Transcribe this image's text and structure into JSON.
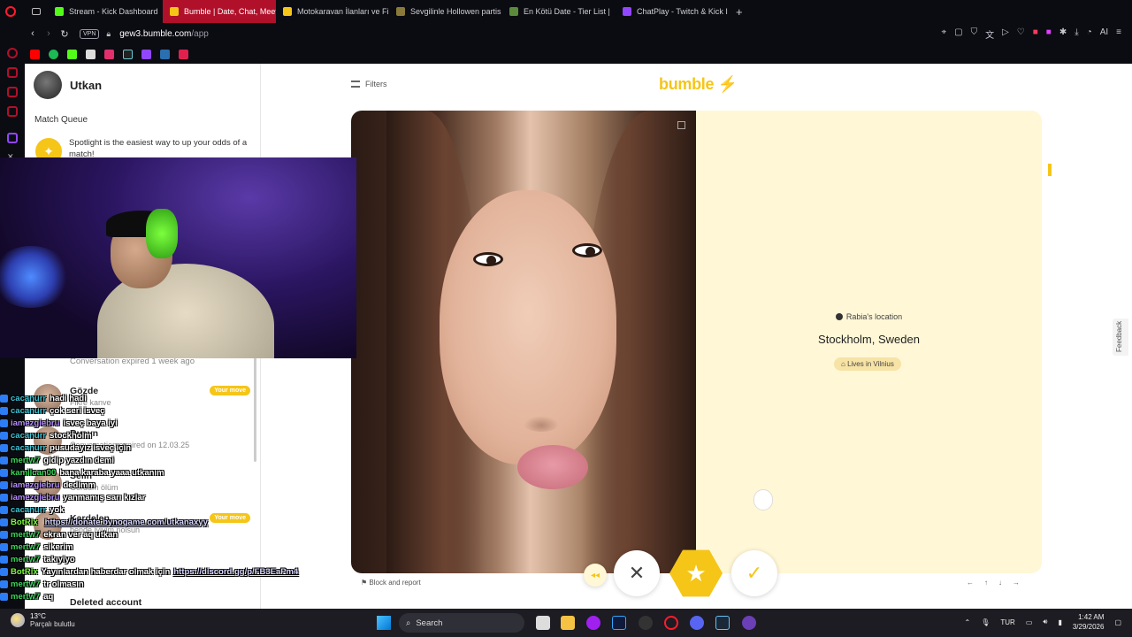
{
  "browser": {
    "tabs": [
      {
        "label": "Stream - Kick Dashboard",
        "color": "#53fc18"
      },
      {
        "label": "Bumble | Date, Chat, Meet",
        "color": "#f5c518",
        "active": true
      },
      {
        "label": "Motokaravan İlanları ve Fi",
        "color": "#f5c518"
      },
      {
        "label": "Sevgilinle Hollowen partis",
        "color": "#8a7a3a"
      },
      {
        "label": "En Kötü Date - Tier List | ",
        "color": "#5a8a3a"
      },
      {
        "label": "ChatPlay - Twitch & Kick I",
        "color": "#9146ff"
      }
    ],
    "new_tab_label": "+",
    "vpn_label": "VPN",
    "url_host": "gew3.bumble.com",
    "url_path": "/app",
    "ai_label": "AI"
  },
  "left_panel": {
    "username": "Utkan",
    "match_queue_title": "Match Queue",
    "spotlight_text": "Spotlight is the easiest way to up your odds of a match!",
    "expired_1": "Conversation expired 1 week ago",
    "conversations": [
      {
        "name": "Gözde",
        "preview": "Fikre kanve",
        "badge": "Your move"
      },
      {
        "name": "Rueyn",
        "preview": "Conversation expired on 12.03.25",
        "badge": ""
      },
      {
        "name": "Selin",
        "preview": "Gördüm ölüm",
        "badge": ""
      },
      {
        "name": "Kardelen",
        "preview": "bende iyiyim nolsun",
        "badge": "Your move"
      }
    ],
    "deleted": "Deleted account"
  },
  "main": {
    "filters_label": "Filters",
    "logo": "bumble ⚡",
    "location_label": "Rabia's location",
    "location_city": "Stockholm, Sweden",
    "lives_in": "Lives in Vilnius",
    "feedback": "Feedback",
    "block_report": "Block and report",
    "btn_back": "◂◂",
    "btn_pass": "✕",
    "btn_super": "★",
    "btn_like": "✓",
    "arrows": [
      "←",
      "↑",
      "↓",
      "→"
    ]
  },
  "chat": [
    {
      "user": "cacanurr",
      "color": "#3ec6d6",
      "msg": "hadi hadi"
    },
    {
      "user": "cacanurr",
      "color": "#3ec6d6",
      "msg": "çok seri isveç"
    },
    {
      "user": "iamezgiebru",
      "color": "#b48cff",
      "msg": "isveç baya iyi"
    },
    {
      "user": "cacanurr",
      "color": "#3ec6d6",
      "msg": "stockholm"
    },
    {
      "user": "cacanurr",
      "color": "#3ec6d6",
      "msg": "pusudayız isveç için"
    },
    {
      "user": "mertw7",
      "color": "#3ad65b",
      "msg": "gidip yazdın demi"
    },
    {
      "user": "kamilcan00",
      "color": "#3ad65b",
      "msg": "bana karaba yaaa utkanım"
    },
    {
      "user": "iamezgiebru",
      "color": "#b48cff",
      "msg": "dedimm"
    },
    {
      "user": "iamezgiebru",
      "color": "#b48cff",
      "msg": "yanmamış sarı kızlar"
    },
    {
      "user": "cacanurr",
      "color": "#3ec6d6",
      "msg": "yok"
    },
    {
      "user": "BotRix",
      "color": "#7cff3e",
      "msg": "",
      "link": "https://donate.bynogame.com/utkanaxyy"
    },
    {
      "user": "mertw7",
      "color": "#3ad65b",
      "msg": "ekran ver aq utkan"
    },
    {
      "user": "mertw7",
      "color": "#3ad65b",
      "msg": "sikerim"
    },
    {
      "user": "mertw7",
      "color": "#3ad65b",
      "msg": "takıyiyo"
    },
    {
      "user": "BotRix",
      "color": "#7cff3e",
      "msg": "Yayınlardan haberdar olmak için",
      "link": "https://discord.gg/p/FB3EaPm4"
    },
    {
      "user": "mertw7",
      "color": "#3ad65b",
      "msg": "tr olmasın"
    },
    {
      "user": "mertw7",
      "color": "#3ad65b",
      "msg": "aq"
    }
  ],
  "taskbar": {
    "temp": "13°C",
    "weather": "Parçalı bulutlu",
    "search": "Search",
    "lang": "TUR",
    "time": "1:42 AM",
    "date": "3/29/2026"
  }
}
